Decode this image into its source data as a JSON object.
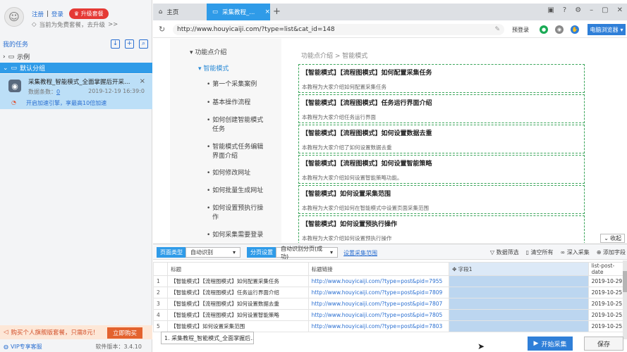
{
  "sidebar": {
    "login_link": "注册",
    "separator": "|",
    "register_link": "登录",
    "upgrade_label": "升级套餐",
    "plan_text": "当前为免费套餐，去升级",
    "plan_arrow": ">>",
    "tasks_title": "我的任务",
    "groups": [
      {
        "label": "示例",
        "expanded": false
      },
      {
        "label": "默认分组",
        "expanded": true
      }
    ],
    "task": {
      "title": "采集教程_智能模式_全面掌握后开采集器的...",
      "count_label": "数据条数：",
      "count_value": "0",
      "date": "2019-12-19 16:39:0",
      "speed_label": "开启加速引擎，享最高10倍加速"
    },
    "promo_text": "购买个人旗舰版套餐，只需8元！",
    "buy_label": "立即购买",
    "vip_label": "VIP专享客服",
    "version": "软件版本：3.4.10"
  },
  "tabs": {
    "home": "主页",
    "active": "采集教程_..."
  },
  "address": {
    "url": "http://www.houyicaiji.com/?type=list&cat_id=148",
    "prelogin": "预登录",
    "browser": "电脑浏览器"
  },
  "page": {
    "menu": [
      {
        "label": "功能点介绍",
        "prefix": "▾"
      },
      {
        "label": "智能模式",
        "prefix": "▾"
      },
      {
        "label": "第一个采集案例",
        "prefix": "•"
      },
      {
        "label": "基本操作流程",
        "prefix": "•"
      },
      {
        "label": "如何创建智能模式",
        "prefix": "•"
      },
      {
        "label": "任务",
        "prefix": ""
      },
      {
        "label": "智能模式任务编辑",
        "prefix": "•"
      },
      {
        "label": "界面介绍",
        "prefix": ""
      },
      {
        "label": "如何修改网址",
        "prefix": "•"
      },
      {
        "label": "如何批量生成网址",
        "prefix": "•"
      },
      {
        "label": "如何设置预执行操",
        "prefix": "•"
      },
      {
        "label": "作",
        "prefix": ""
      },
      {
        "label": "如何采集需要登录",
        "prefix": "•"
      }
    ],
    "breadcrumb": "功能点介绍 > 智能模式",
    "articles": [
      {
        "title": "【智能模式】【流程图模式】如何配置采集任务",
        "desc": "本教程为大家介绍如何配置采集任务"
      },
      {
        "title": "【智能模式】【流程图模式】任务运行界面介绍",
        "desc": "本教程为大家介绍任务运行界面"
      },
      {
        "title": "【智能模式】【流程图模式】如何设置数据去重",
        "desc": "本教程为大家介绍了如何设置数据去重"
      },
      {
        "title": "【智能模式】【流程图模式】如何设置智能策略",
        "desc": "本教程为大家介绍如何设置智能策略功能。"
      },
      {
        "title": "【智能模式】如何设置采集范围",
        "desc": "本教程为大家介绍如何在智能模式中设置页面采集范围"
      },
      {
        "title": "【智能模式】如何设置预执行操作",
        "desc": "本教程为大家介绍如何设置预执行操作"
      }
    ],
    "collapse_label": "收起"
  },
  "toolbar": {
    "page_type_label": "页面类型",
    "page_type_value": "自动识别",
    "paging_label": "分页设置",
    "paging_value": "自动识别分页(成功)",
    "paging_link": "设置采集范围",
    "filter": "数据筛选",
    "clear": "清空所有",
    "deep": "深入采集",
    "add_field": "添加字段"
  },
  "table": {
    "columns": [
      "",
      "标题",
      "标题链接",
      "字段1",
      "list-post-date"
    ],
    "rows": [
      [
        "1",
        "【智能模式】【流程图模式】如何配置采集任务",
        "http://www.houyicaiji.com/?type=post&pid=7955",
        "",
        "2019-10-29..."
      ],
      [
        "2",
        "【智能模式】【流程图模式】任务运行界面介绍",
        "http://www.houyicaiji.com/?type=post&pid=7809",
        "",
        "2019-10-25..."
      ],
      [
        "3",
        "【智能模式】【流程图模式】如何设置数据去重",
        "http://www.houyicaiji.com/?type=post&pid=7807",
        "",
        "2019-10-25..."
      ],
      [
        "4",
        "【智能模式】【流程图模式】如何设置智能策略",
        "http://www.houyicaiji.com/?type=post&pid=7805",
        "",
        "2019-10-25..."
      ],
      [
        "5",
        "【智能模式】如何设置采集范围",
        "http://www.houyicaiji.com/?type=post&pid=7803",
        "",
        "2019-10-25..."
      ]
    ]
  },
  "status_tab": "1. 采集教程_智能模式_全面掌握后...",
  "start_label": "开始采集",
  "save_label": "保存"
}
